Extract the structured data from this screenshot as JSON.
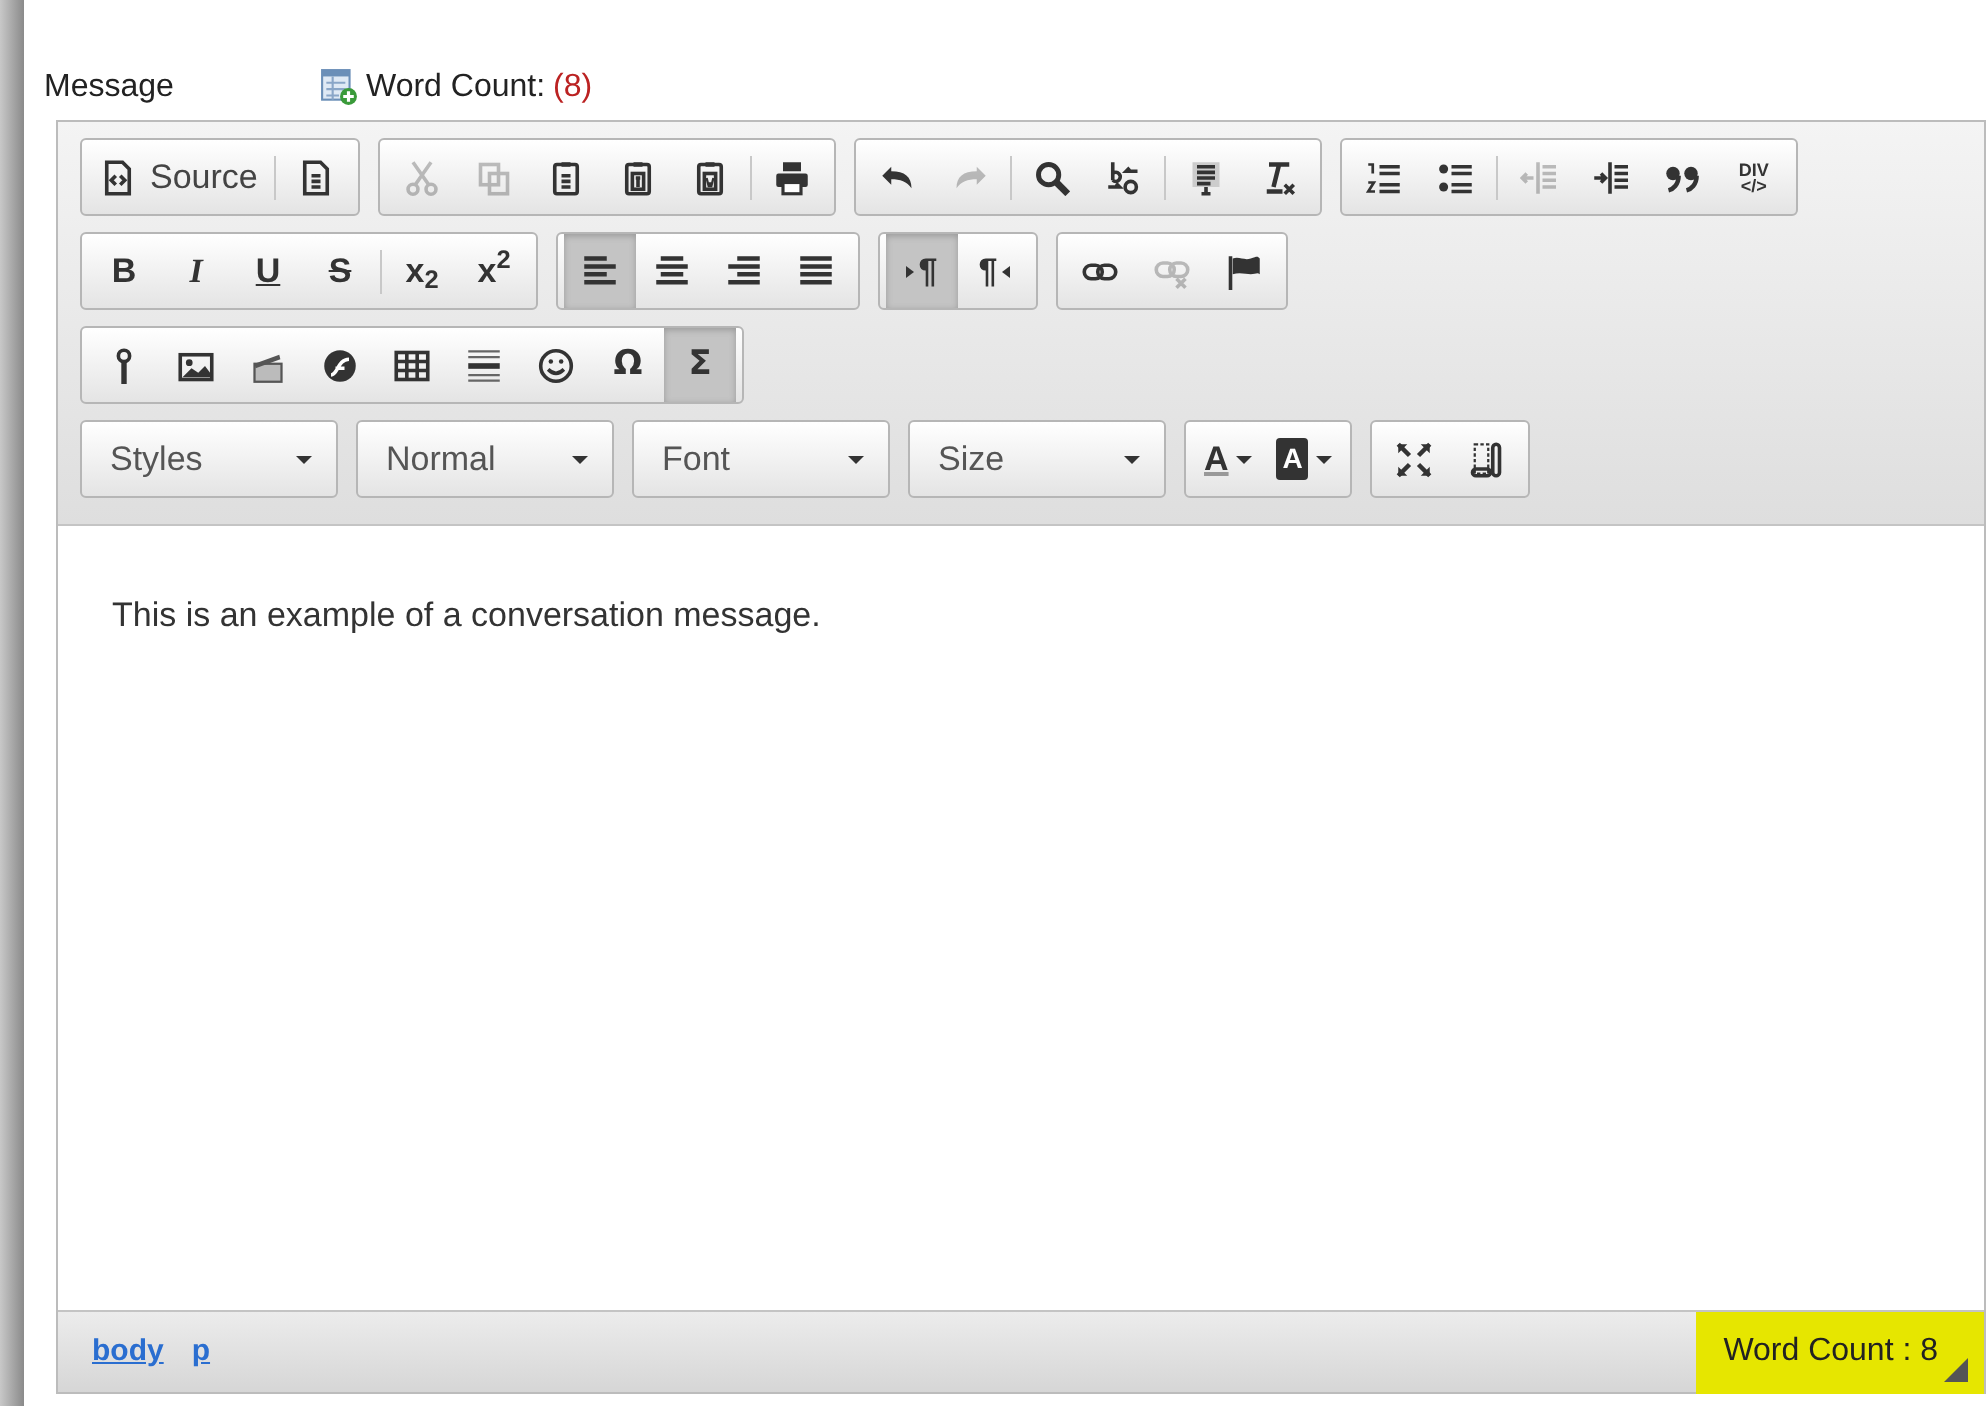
{
  "field_label": "Message",
  "word_count": {
    "label": "Word Count:",
    "value": "(8)"
  },
  "toolbar": {
    "rows": [
      {
        "groups": [
          {
            "buttons": [
              {
                "kind": "source",
                "label": "Source",
                "disabled": false
              },
              {
                "kind": "separator"
              },
              {
                "kind": "newpage",
                "disabled": false
              }
            ]
          },
          {
            "buttons": [
              {
                "kind": "cut",
                "disabled": true
              },
              {
                "kind": "copy",
                "disabled": true
              },
              {
                "kind": "paste",
                "disabled": false
              },
              {
                "kind": "pastetext",
                "disabled": false
              },
              {
                "kind": "pasteword",
                "disabled": false
              },
              {
                "kind": "separator"
              },
              {
                "kind": "print",
                "disabled": false
              }
            ]
          },
          {
            "buttons": [
              {
                "kind": "undo",
                "disabled": false
              },
              {
                "kind": "redo",
                "disabled": true
              },
              {
                "kind": "separator"
              },
              {
                "kind": "find",
                "disabled": false
              },
              {
                "kind": "replace",
                "disabled": false
              },
              {
                "kind": "separator"
              },
              {
                "kind": "selectall",
                "disabled": false
              },
              {
                "kind": "removeformat",
                "disabled": false
              }
            ]
          },
          {
            "buttons": [
              {
                "kind": "numbered",
                "disabled": false
              },
              {
                "kind": "bulleted",
                "disabled": false
              },
              {
                "kind": "separator"
              },
              {
                "kind": "outdent",
                "disabled": true
              },
              {
                "kind": "indent",
                "disabled": false
              },
              {
                "kind": "blockquote",
                "disabled": false
              },
              {
                "kind": "div",
                "label": "DIV",
                "sublabel": "</>",
                "disabled": false
              }
            ]
          }
        ]
      },
      {
        "groups": [
          {
            "buttons": [
              {
                "kind": "bold",
                "label": "B",
                "disabled": false
              },
              {
                "kind": "italic",
                "label": "I",
                "disabled": false
              },
              {
                "kind": "underline",
                "label": "U",
                "disabled": false
              },
              {
                "kind": "strike",
                "label": "S",
                "disabled": false
              },
              {
                "kind": "separator"
              },
              {
                "kind": "script",
                "label": "x$_{2}$",
                "disabled": false
              },
              {
                "kind": "script",
                "label": "x$^{2}$",
                "disabled": false
              }
            ]
          },
          {
            "buttons": [
              {
                "kind": "alignleft",
                "selected": true
              },
              {
                "kind": "aligncenter",
                "selected": false
              },
              {
                "kind": "alignright",
                "selected": false
              },
              {
                "kind": "justify",
                "selected": false
              }
            ]
          },
          {
            "buttons": [
              {
                "kind": "ltr",
                "label": "¶",
                "selected": true
              },
              {
                "kind": "rtl",
                "label": "¶",
                "selected": false
              }
            ]
          },
          {
            "buttons": [
              {
                "kind": "link",
                "disabled": false
              },
              {
                "kind": "unlink",
                "disabled": true
              },
              {
                "kind": "anchor",
                "disabled": false
              }
            ]
          }
        ]
      },
      {
        "groups": [
          {
            "buttons": [
              {
                "kind": "pin",
                "disabled": false
              },
              {
                "kind": "image",
                "disabled": false
              },
              {
                "kind": "video",
                "disabled": false
              },
              {
                "kind": "flash",
                "disabled": false
              },
              {
                "kind": "table",
                "disabled": false
              },
              {
                "kind": "hr",
                "disabled": false
              },
              {
                "kind": "smiley",
                "disabled": false
              },
              {
                "kind": "symbol",
                "label": "Ω",
                "disabled": false
              },
              {
                "kind": "symbol",
                "label": "Σ",
                "selected": true
              }
            ]
          }
        ]
      },
      {
        "groups": [
          {
            "kind": "combo",
            "label": "Styles"
          },
          {
            "kind": "combo",
            "label": "Normal"
          },
          {
            "kind": "combo",
            "label": "Font"
          },
          {
            "kind": "combo",
            "label": "Size"
          },
          {
            "buttons": [
              {
                "kind": "textcolor",
                "label": "A"
              },
              {
                "kind": "bgcolor",
                "label": "A"
              }
            ]
          },
          {
            "buttons": [
              {
                "kind": "maximize",
                "disabled": false
              },
              {
                "kind": "showblocks",
                "disabled": false
              }
            ]
          }
        ]
      }
    ]
  },
  "content": "This is an example of a conversation message.",
  "footer": {
    "path": [
      "body",
      "p"
    ],
    "word_count": "Word Count : 8"
  }
}
